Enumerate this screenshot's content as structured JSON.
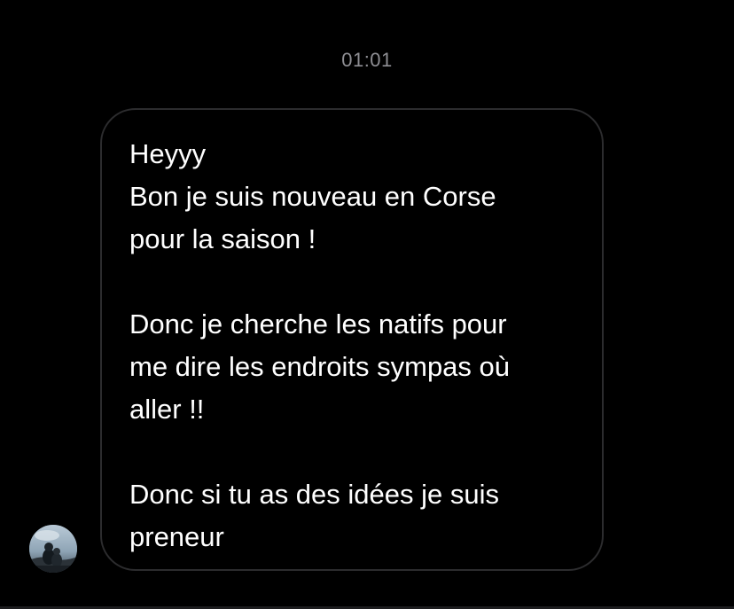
{
  "conversation": {
    "timestamp": "01:01",
    "message": {
      "lines": [
        "Heyyy",
        "Bon je suis nouveau en Corse",
        "pour la saison !",
        "",
        "Donc je cherche les natifs pour",
        "me dire les endroits sympas où",
        "aller !!",
        "",
        "Donc si tu as des idées je suis",
        "preneur"
      ]
    },
    "sender": {
      "avatar_icon": "profile-photo-icon"
    }
  },
  "colors": {
    "background": "#000000",
    "bubble_border": "#2c2c2e",
    "text": "#ffffff",
    "timestamp": "#8e8e93"
  }
}
